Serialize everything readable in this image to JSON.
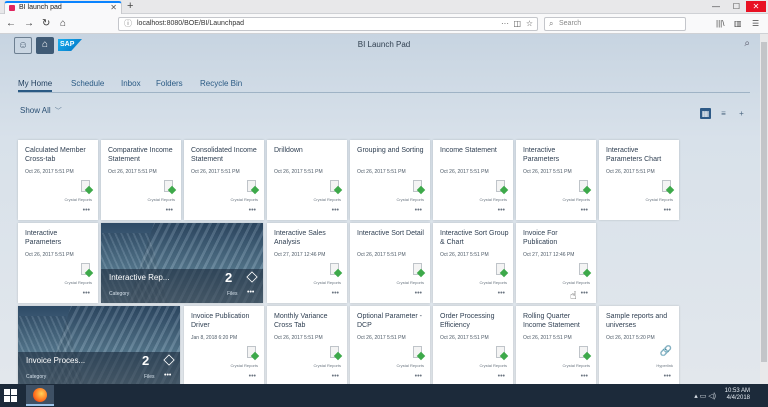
{
  "browser": {
    "tab_title": "BI launch pad",
    "url": "localhost:8080/BOE/BI/Launchpad",
    "search_placeholder": "Search"
  },
  "app": {
    "title": "BI Launch Pad",
    "brand": "SAP"
  },
  "nav_tabs": [
    "My Home",
    "Schedule",
    "Inbox",
    "Folders",
    "Recycle Bin"
  ],
  "filter_label": "Show All",
  "doc_type": "Crystal Reports",
  "tiles": [
    {
      "title": "Calculated Member Cross-tab",
      "date": "Oct 26, 2017 5:51 PM",
      "type": "Crystal Reports"
    },
    {
      "title": "Comparative Income Statement",
      "date": "Oct 26, 2017 5:51 PM",
      "type": "Crystal Reports"
    },
    {
      "title": "Consolidated Income Statement",
      "date": "Oct 26, 2017 5:51 PM",
      "type": "Crystal Reports"
    },
    {
      "title": "Drilldown",
      "date": "Oct 26, 2017 5:51 PM",
      "type": "Crystal Reports"
    },
    {
      "title": "Grouping and Sorting",
      "date": "Oct 26, 2017 5:51 PM",
      "type": "Crystal Reports"
    },
    {
      "title": "Income Statement",
      "date": "Oct 26, 2017 5:51 PM",
      "type": "Crystal Reports"
    },
    {
      "title": "Interactive Parameters",
      "date": "Oct 26, 2017 5:51 PM",
      "type": "Crystal Reports"
    },
    {
      "title": "Interactive Parameters Chart",
      "date": "Oct 26, 2017 5:51 PM",
      "type": "Crystal Reports"
    },
    {
      "title": "Interactive Parameters",
      "date": "Oct 26, 2017 5:51 PM",
      "type": "Crystal Reports"
    },
    {
      "title": "Interactive Sales Analysis",
      "date": "Oct 27, 2017 12:46 PM",
      "type": "Crystal Reports"
    },
    {
      "title": "Interactive Sort Detail",
      "date": "Oct 26, 2017 5:51 PM",
      "type": "Crystal Reports"
    },
    {
      "title": "Interactive Sort Group & Chart",
      "date": "Oct 26, 2017 5:51 PM",
      "type": "Crystal Reports"
    },
    {
      "title": "Invoice For Publication",
      "date": "Oct 27, 2017 12:46 PM",
      "type": "Crystal Reports"
    },
    {
      "title": "Invoice Publication Driver",
      "date": "Jan 8, 2018 6:20 PM",
      "type": "Crystal Reports"
    },
    {
      "title": "Monthly Variance Cross Tab",
      "date": "Oct 26, 2017 5:51 PM",
      "type": "Crystal Reports"
    },
    {
      "title": "Optional Parameter - DCP",
      "date": "Oct 26, 2017 5:51 PM",
      "type": "Crystal Reports"
    },
    {
      "title": "Order Processing Efficiency",
      "date": "Oct 26, 2017 5:51 PM",
      "type": "Crystal Reports"
    },
    {
      "title": "Rolling Quarter Income Statement",
      "date": "Oct 26, 2017 5:51 PM",
      "type": "Crystal Reports"
    },
    {
      "title": "Sample reports and universes",
      "date": "Oct 26, 2017 5:20 PM",
      "type": "Hyperlink"
    }
  ],
  "folders": [
    {
      "name": "Interactive Rep...",
      "category": "Category",
      "count": "2",
      "files_label": "Files"
    },
    {
      "name": "Invoice Proces...",
      "category": "Category",
      "count": "2",
      "files_label": "Files"
    }
  ],
  "more_glyph": "•••",
  "taskbar": {
    "time": "10:53 AM",
    "date": "4/4/2018"
  }
}
